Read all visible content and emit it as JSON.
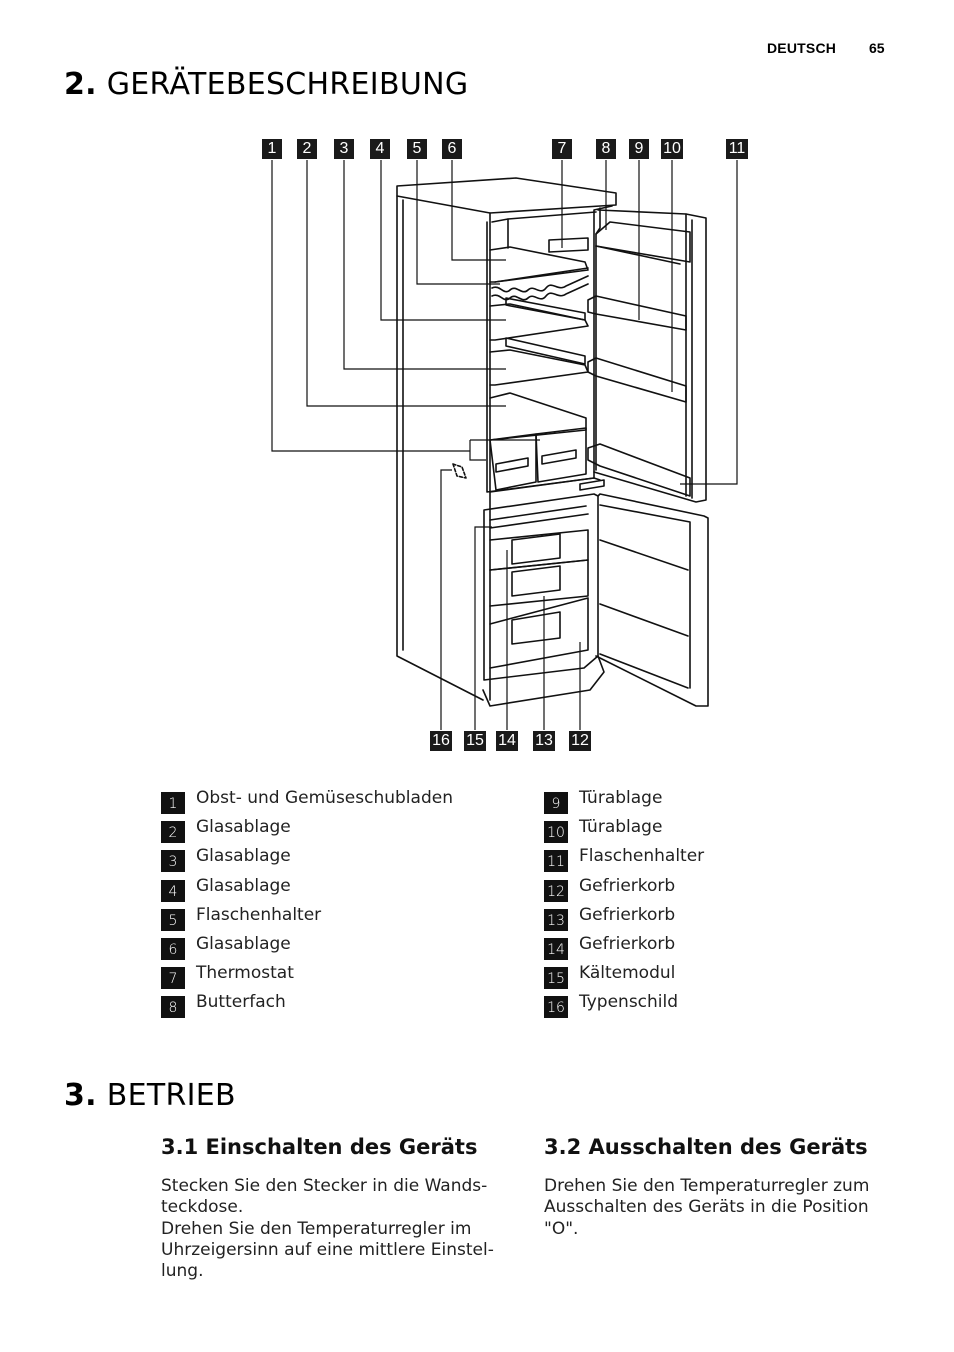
{
  "header": {
    "language": "DEUTSCH",
    "page_number": "65"
  },
  "section2": {
    "number": "2.",
    "title": "GERÄTEBESCHREIBUNG",
    "figure": {
      "callouts_top": [
        "1",
        "2",
        "3",
        "4",
        "5",
        "6",
        "7",
        "8",
        "9",
        "10",
        "11"
      ],
      "callouts_bottom": [
        "16",
        "15",
        "14",
        "13",
        "12"
      ],
      "hatch_mark": "//"
    },
    "legend_left": [
      {
        "num": "1",
        "label": "Obst- und Gemüseschubladen"
      },
      {
        "num": "2",
        "label": "Glasablage"
      },
      {
        "num": "3",
        "label": "Glasablage"
      },
      {
        "num": "4",
        "label": "Glasablage"
      },
      {
        "num": "5",
        "label": "Flaschenhalter"
      },
      {
        "num": "6",
        "label": "Glasablage"
      },
      {
        "num": "7",
        "label": "Thermostat"
      },
      {
        "num": "8",
        "label": "Butterfach"
      }
    ],
    "legend_right": [
      {
        "num": "9",
        "label": "Türablage"
      },
      {
        "num": "10",
        "label": "Türablage"
      },
      {
        "num": "11",
        "label": "Flaschenhalter"
      },
      {
        "num": "12",
        "label": "Gefrierkorb"
      },
      {
        "num": "13",
        "label": "Gefrierkorb"
      },
      {
        "num": "14",
        "label": "Gefrierkorb"
      },
      {
        "num": "15",
        "label": "Kältemodul"
      },
      {
        "num": "16",
        "label": "Typenschild"
      }
    ]
  },
  "section3": {
    "number": "3.",
    "title": "BETRIEB",
    "sub1": {
      "number": "3.1",
      "title": "Einschalten des Geräts",
      "lines": [
        "Stecken Sie den Stecker in die Wands-",
        "teckdose.",
        "Drehen Sie den Temperaturregler im",
        "Uhrzeigersinn auf eine mittlere Einstel-",
        "lung."
      ]
    },
    "sub2": {
      "number": "3.2",
      "title": "Ausschalten des Geräts",
      "lines": [
        "Drehen Sie den Temperaturregler zum",
        "Ausschalten des Geräts in die Position",
        "\"O\"."
      ]
    }
  }
}
